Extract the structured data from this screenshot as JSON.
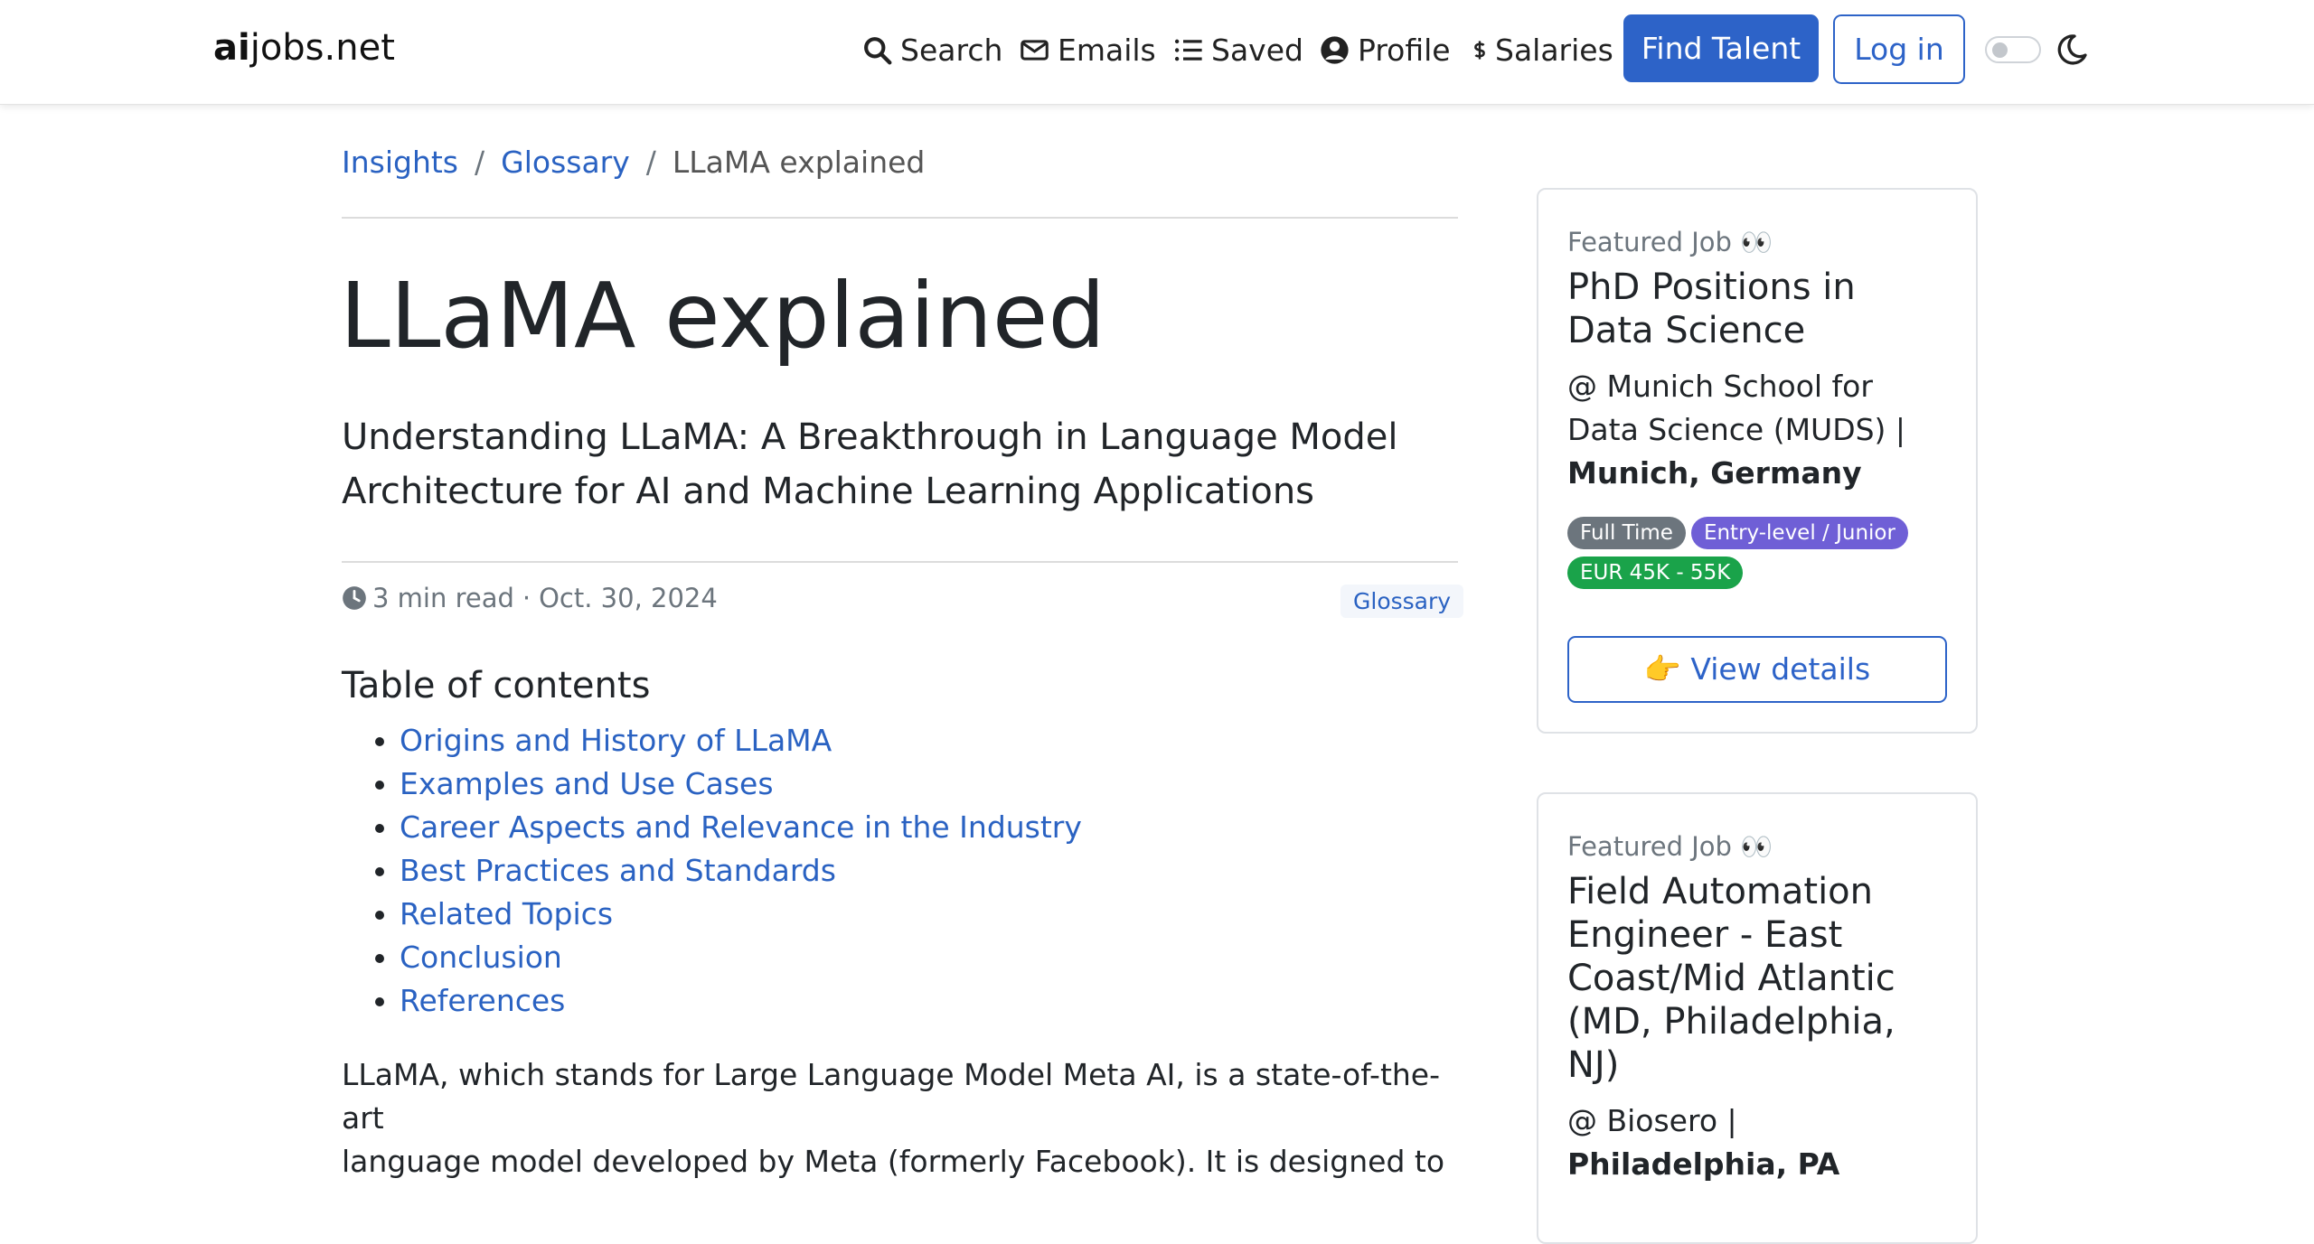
{
  "navbar": {
    "brand_bold": "ai",
    "brand_rest": "jobs.net",
    "items": [
      {
        "label": "Search",
        "icon": "search-icon"
      },
      {
        "label": "Emails",
        "icon": "envelope-icon"
      },
      {
        "label": "Saved",
        "icon": "list-icon"
      },
      {
        "label": "Profile",
        "icon": "user-circle-icon"
      },
      {
        "label": "Salaries",
        "icon": "dollar-icon"
      }
    ],
    "find_talent": "Find Talent",
    "login": "Log in",
    "theme_toggle": "off"
  },
  "breadcrumb": {
    "items": [
      "Insights",
      "Glossary"
    ],
    "current": "LLaMA explained"
  },
  "article": {
    "title": "LLaMA explained",
    "subtitle": "Understanding LLaMA: A Breakthrough in Language Model Architecture for AI and Machine Learning Applications",
    "read_time": "3 min read",
    "date": "Oct. 30, 2024",
    "category": "Glossary",
    "toc_title": "Table of contents",
    "toc": [
      "Origins and History of LLaMA",
      "Examples and Use Cases",
      "Career Aspects and Relevance in the Industry",
      "Best Practices and Standards",
      "Related Topics",
      "Conclusion",
      "References"
    ],
    "intro_line1": "LLaMA, which stands for Large Language Model Meta AI, is a state-of-the-art",
    "intro_line2": "language model developed by Meta (formerly Facebook). It is designed to"
  },
  "featured_jobs": [
    {
      "label": "Featured Job 👀",
      "title": "PhD Positions in Data Science",
      "company": "@ Munich School for Data Science (MUDS)",
      "location": "Munich, Germany",
      "badges": [
        "Full Time",
        "Entry-level / Junior",
        "EUR 45K - 55K"
      ],
      "button": "👉 View details"
    },
    {
      "label": "Featured Job 👀",
      "title": "Field Automation Engineer - East Coast/Mid Atlantic (MD, Philadelphia, NJ)",
      "company": "@ Biosero",
      "location": "Philadelphia, PA"
    }
  ],
  "colors": {
    "primary": "#2d63c8",
    "badge_gray": "#6c757d",
    "badge_purple": "#6f5fd6",
    "badge_green": "#1aa34a"
  }
}
